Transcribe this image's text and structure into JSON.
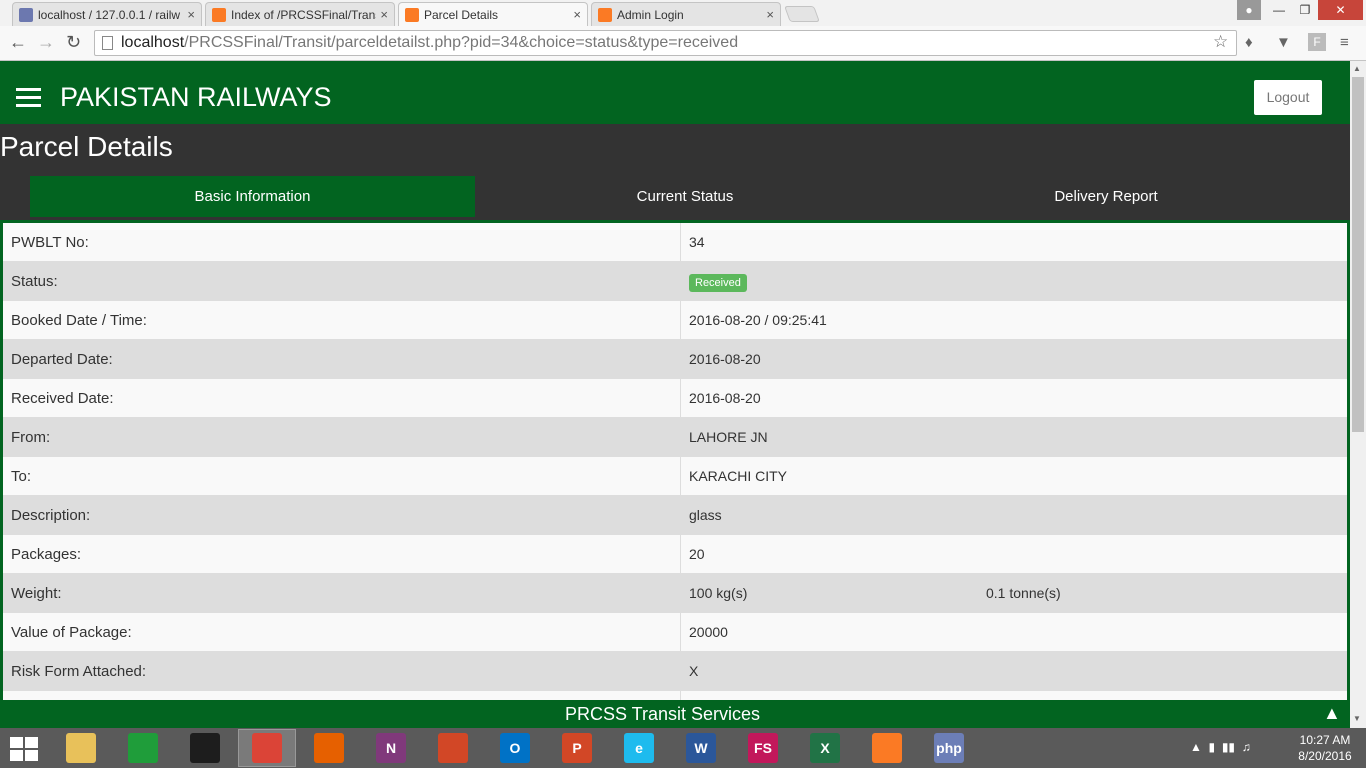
{
  "browser": {
    "tabs": [
      {
        "title": "localhost / 127.0.0.1 / railw",
        "icon": "phpmyadmin-icon",
        "active": false
      },
      {
        "title": "Index of /PRCSSFinal/Trans",
        "icon": "xampp-icon",
        "active": false
      },
      {
        "title": "Parcel Details",
        "icon": "xampp-icon",
        "active": true
      },
      {
        "title": "Admin Login",
        "icon": "xampp-icon",
        "active": false
      }
    ],
    "close_glyph": "×",
    "url_host": "localhost",
    "url_path": "/PRCSSFinal/Transit/parceldetailst.php?pid=34&choice=status&type=received"
  },
  "header": {
    "brand": "PAKISTAN RAILWAYS",
    "logout_label": "Logout"
  },
  "page": {
    "title": "Parcel Details",
    "tabs": [
      "Basic Information",
      "Current Status",
      "Delivery Report"
    ],
    "active_tab": "Basic Information"
  },
  "details": [
    {
      "label": "PWBLT No:",
      "value": "34"
    },
    {
      "label": "Status:",
      "badge": "Received",
      "badge_color": "#5cb85c"
    },
    {
      "label": "Booked Date / Time:",
      "value": "2016-08-20 / 09:25:41"
    },
    {
      "label": "Departed Date:",
      "value": "2016-08-20"
    },
    {
      "label": "Received Date:",
      "value": "2016-08-20"
    },
    {
      "label": "From:",
      "value": "LAHORE JN"
    },
    {
      "label": "To:",
      "value": "KARACHI CITY"
    },
    {
      "label": "Description:",
      "value": "glass"
    },
    {
      "label": "Packages:",
      "value": "20"
    },
    {
      "label": "Weight:",
      "value": "100 kg(s)",
      "value2": "0.1 tonne(s)"
    },
    {
      "label": "Value of Package:",
      "value": "20000"
    },
    {
      "label": "Risk Form Attached:",
      "value": "X"
    }
  ],
  "footer": {
    "text": "PRCSS Transit Services"
  },
  "taskbar": {
    "apps": [
      {
        "name": "file-explorer-icon",
        "label": "",
        "color": "#e8c15a"
      },
      {
        "name": "store-icon",
        "label": "",
        "color": "#1f9d3a"
      },
      {
        "name": "cmd-icon",
        "label": "",
        "color": "#1d1d1d"
      },
      {
        "name": "chrome-icon",
        "label": "",
        "color": "#db4437",
        "active": true
      },
      {
        "name": "firefox-icon",
        "label": "",
        "color": "#e66000"
      },
      {
        "name": "onenote-icon",
        "label": "N",
        "color": "#80397b"
      },
      {
        "name": "apps-grid-icon",
        "label": "",
        "color": "#d24726"
      },
      {
        "name": "outlook-icon",
        "label": "O",
        "color": "#0072c6"
      },
      {
        "name": "powerpoint-icon",
        "label": "P",
        "color": "#d24726"
      },
      {
        "name": "internet-explorer-icon",
        "label": "e",
        "color": "#1ebbee"
      },
      {
        "name": "word-icon",
        "label": "W",
        "color": "#2b579a"
      },
      {
        "name": "fs-icon",
        "label": "FS",
        "color": "#c2185b"
      },
      {
        "name": "excel-icon",
        "label": "X",
        "color": "#217346"
      },
      {
        "name": "xampp-icon",
        "label": "",
        "color": "#fb7a24"
      },
      {
        "name": "php-icon",
        "label": "php",
        "color": "#6c7eb7"
      }
    ],
    "time": "10:27 AM",
    "date": "8/20/2016"
  },
  "colors": {
    "brand_green": "#026420",
    "dark": "#333333"
  }
}
